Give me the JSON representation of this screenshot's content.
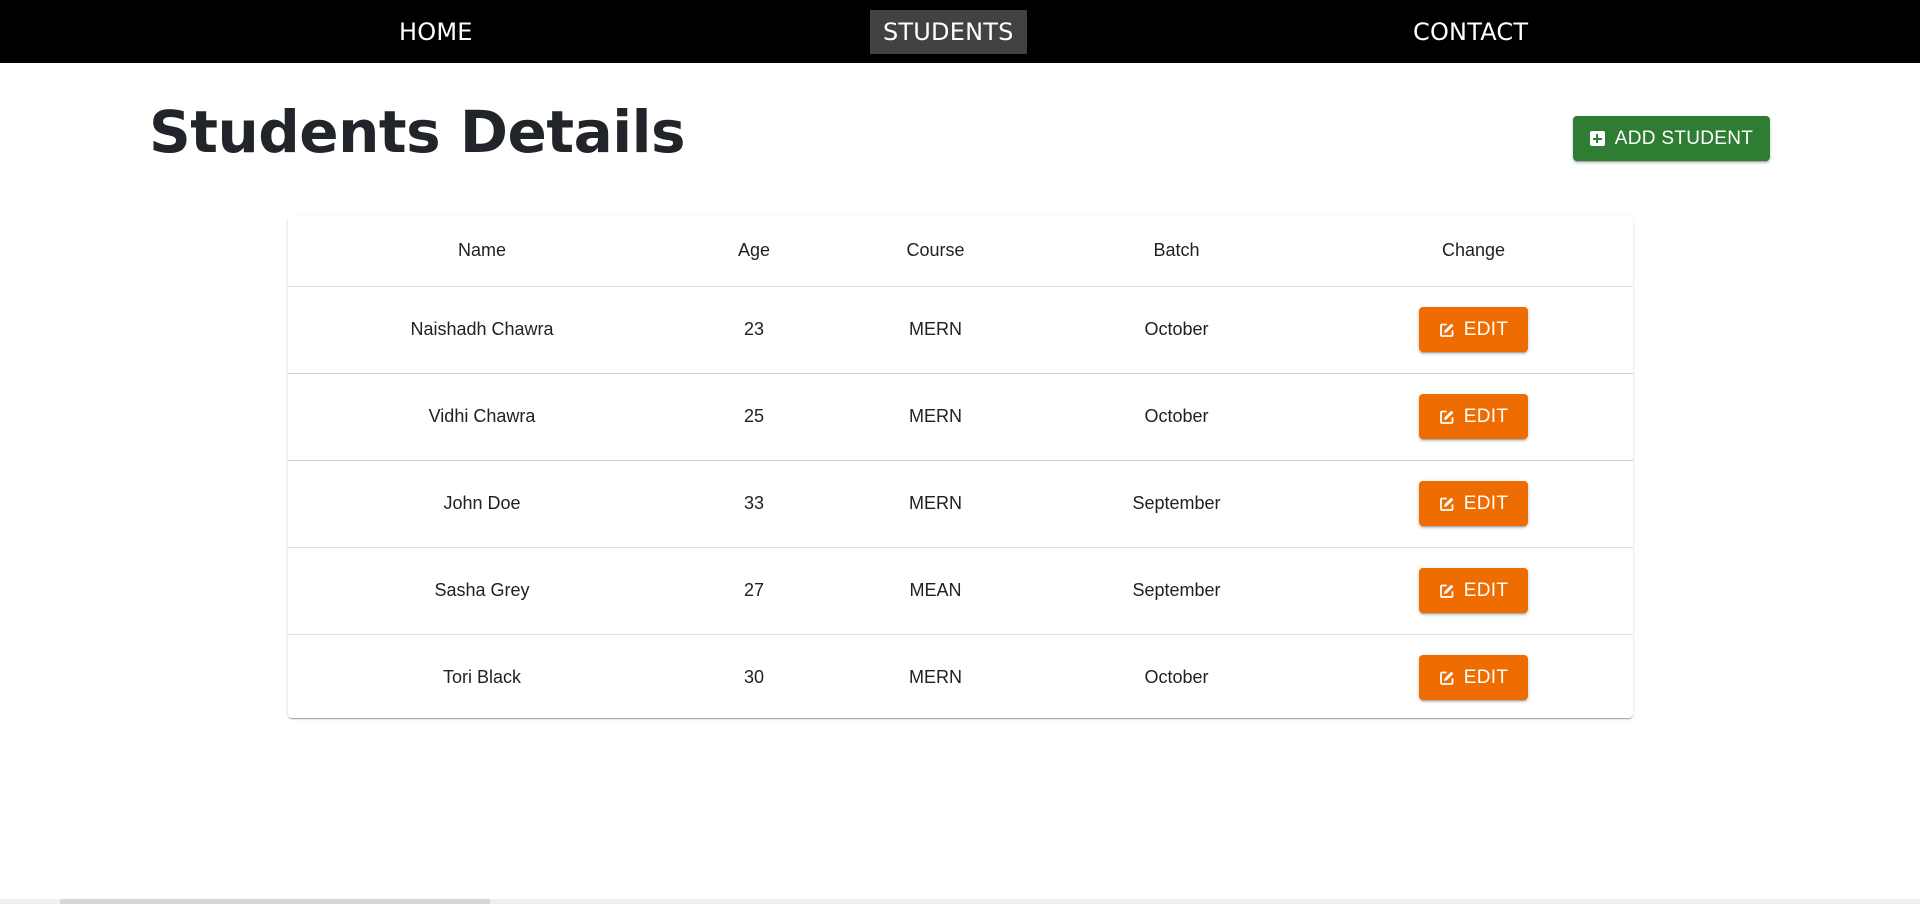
{
  "nav": {
    "items": [
      {
        "label": "HOME",
        "active": false
      },
      {
        "label": "STUDENTS",
        "active": true
      },
      {
        "label": "CONTACT",
        "active": false
      }
    ]
  },
  "page": {
    "title": "Students Details",
    "add_button_label": "ADD STUDENT",
    "add_button_icon": "plus-square-icon"
  },
  "table": {
    "headers": [
      "Name",
      "Age",
      "Course",
      "Batch",
      "Change"
    ],
    "rows": [
      {
        "name": "Naishadh Chawra",
        "age": "23",
        "course": "MERN",
        "batch": "October",
        "action": "EDIT"
      },
      {
        "name": "Vidhi Chawra",
        "age": "25",
        "course": "MERN",
        "batch": "October",
        "action": "EDIT"
      },
      {
        "name": "John Doe",
        "age": "33",
        "course": "MERN",
        "batch": "September",
        "action": "EDIT"
      },
      {
        "name": "Sasha Grey",
        "age": "27",
        "course": "MEAN",
        "batch": "September",
        "action": "EDIT"
      },
      {
        "name": "Tori Black",
        "age": "30",
        "course": "MERN",
        "batch": "October",
        "action": "EDIT"
      }
    ],
    "edit_icon": "edit-icon"
  },
  "colors": {
    "navbar_bg": "#000000",
    "nav_active_bg": "#424242",
    "add_button": "#2e7d32",
    "edit_button": "#ef6c00",
    "title_text": "#212529"
  }
}
